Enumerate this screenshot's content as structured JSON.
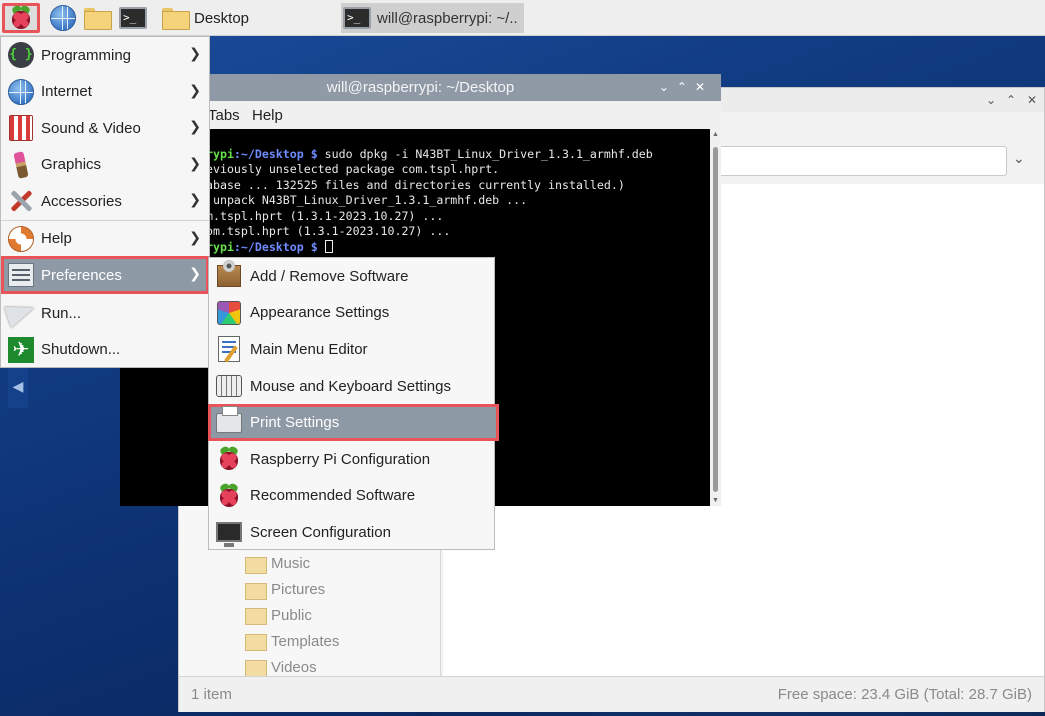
{
  "taskbar": {
    "desktop_label": "Desktop",
    "window_label": "will@raspberrypi: ~/..",
    "icons": [
      "raspberry-pi-menu-icon",
      "globe-icon",
      "folder-icon",
      "terminal-icon"
    ]
  },
  "terminal": {
    "title": "will@raspberrypi: ~/Desktop",
    "menu": [
      "Tabs",
      "Help"
    ],
    "lines": [
      {
        "prompt_user": "rypi",
        "prompt_path": ":~/Desktop $",
        "text": " sudo dpkg -i N43BT_Linux_Driver_1.3.1_armhf.deb"
      },
      {
        "text": "eviously unselected package com.tspl.hprt."
      },
      {
        "text": "abase ... 132525 files and directories currently installed.)"
      },
      {
        "text": " unpack N43BT_Linux_Driver_1.3.1_armhf.deb ..."
      },
      {
        "text": "m.tspl.hprt (1.3.1-2023.10.27) ..."
      },
      {
        "text": "om.tspl.hprt (1.3.1-2023.10.27) ..."
      },
      {
        "prompt_user": "rypi",
        "prompt_path": ":~/Desktop $",
        "text": " "
      }
    ]
  },
  "file_manager": {
    "tree": [
      "Music",
      "Pictures",
      "Public",
      "Templates",
      "Videos"
    ],
    "status_left": "1 item",
    "status_right": "Free space: 23.4 GiB (Total: 28.7 GiB)"
  },
  "main_menu": {
    "items": [
      {
        "label": "Programming",
        "icon": "programming-icon",
        "submenu": true
      },
      {
        "label": "Internet",
        "icon": "globe-icon",
        "submenu": true
      },
      {
        "label": "Sound & Video",
        "icon": "sound-video-icon",
        "submenu": true
      },
      {
        "label": "Graphics",
        "icon": "graphics-icon",
        "submenu": true
      },
      {
        "label": "Accessories",
        "icon": "accessories-icon",
        "submenu": true
      },
      {
        "label": "Help",
        "icon": "help-icon",
        "submenu": true
      },
      {
        "label": "Preferences",
        "icon": "preferences-icon",
        "submenu": true,
        "active": true
      },
      {
        "label": "Run...",
        "icon": "run-icon",
        "submenu": false
      },
      {
        "label": "Shutdown...",
        "icon": "shutdown-icon",
        "submenu": false
      }
    ]
  },
  "preferences_submenu": {
    "items": [
      {
        "label": "Add / Remove Software",
        "icon": "add-remove-software-icon"
      },
      {
        "label": "Appearance Settings",
        "icon": "appearance-settings-icon"
      },
      {
        "label": "Main Menu Editor",
        "icon": "menu-editor-icon"
      },
      {
        "label": "Mouse and Keyboard Settings",
        "icon": "keyboard-icon"
      },
      {
        "label": "Print Settings",
        "icon": "printer-icon",
        "active": true
      },
      {
        "label": "Raspberry Pi Configuration",
        "icon": "raspberry-pi-icon"
      },
      {
        "label": "Recommended Software",
        "icon": "raspberry-pi-icon"
      },
      {
        "label": "Screen Configuration",
        "icon": "monitor-icon"
      }
    ]
  },
  "colors": {
    "highlight_outline": "#e8545a",
    "selection": "#8e99a6",
    "desktop": "#123d84",
    "prompt_green": "#68e04c",
    "prompt_blue": "#6f8bff"
  }
}
